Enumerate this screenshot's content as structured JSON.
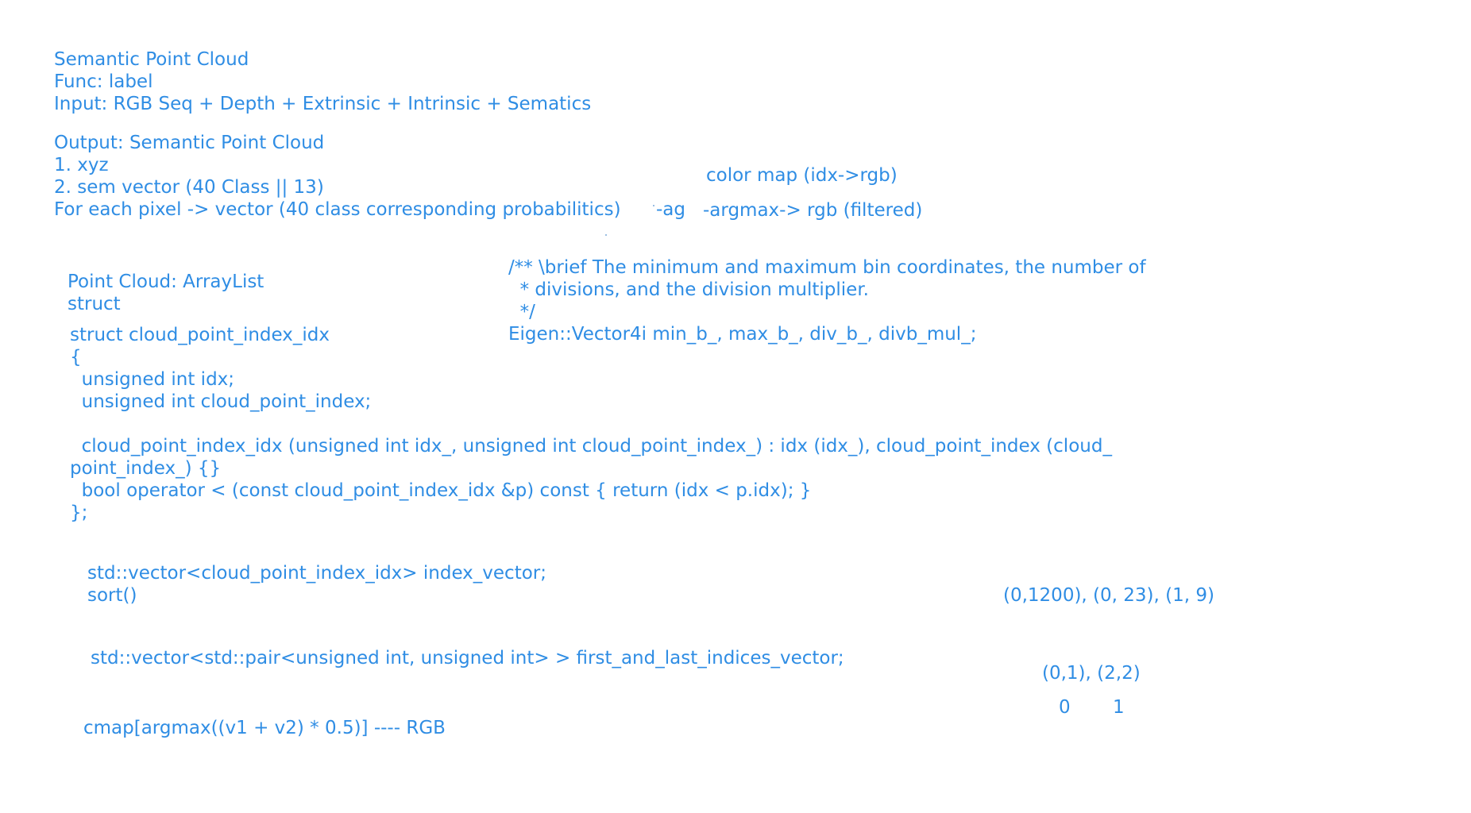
{
  "header": {
    "title": "Semantic Point Cloud",
    "func": "Func: label",
    "input": "Input: RGB Seq + Depth + Extrinsic + Intrinsic + Sematics"
  },
  "output": {
    "title": "Output: Semantic Point Cloud",
    "item1": "1. xyz",
    "item2": "2. sem vector (40 Class || 13)",
    "per_pixel": "For each pixel -> vector (40 class corresponding probabilitics)",
    "argmax_stub": "-ag"
  },
  "color_map": {
    "label": "color map (idx->rgb)",
    "argmax": "-argmax-> rgb (filtered)"
  },
  "point_cloud": {
    "title": "Point Cloud: ArrayList",
    "struct": "struct"
  },
  "struct_code": {
    "line1": "struct cloud_point_index_idx",
    "line2": "{",
    "line3": "  unsigned int idx;",
    "line4": "  unsigned int cloud_point_index;",
    "line5": "  cloud_point_index_idx (unsigned int idx_, unsigned int cloud_point_index_) : idx (idx_), cloud_point_index (cloud_",
    "line6": "point_index_) {}",
    "line7": "  bool operator < (const cloud_point_index_idx &p) const { return (idx < p.idx); }",
    "line8": "};"
  },
  "doc_comment": {
    "line1": "/** \\brief The minimum and maximum bin coordinates, the number of",
    "line2": "  * divisions, and the division multiplier.",
    "line3": "  */",
    "line4": "Eigen::Vector4i min_b_, max_b_, div_b_, divb_mul_;"
  },
  "vector_code": {
    "decl": "std::vector<cloud_point_index_idx> index_vector;",
    "sort": "sort()",
    "pairs": "std::vector<std::pair<unsigned int, unsigned int> > first_and_last_indices_vector;",
    "cmap": "cmap[argmax((v1 + v2) * 0.5)] ---- RGB"
  },
  "examples": {
    "pairs1": "(0,1200), (0, 23), (1, 9)",
    "pairs2": "(0,1), (2,2)",
    "idx0": "0",
    "idx1": "1"
  }
}
